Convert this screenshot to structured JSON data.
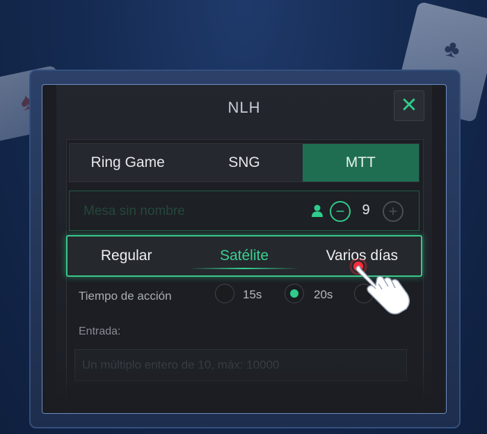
{
  "dialog": {
    "title": "NLH",
    "close_icon": "close-icon",
    "accent_color": "#2fcc8c"
  },
  "game_tabs": [
    {
      "label": "Ring Game",
      "active": false
    },
    {
      "label": "SNG",
      "active": false
    },
    {
      "label": "MTT",
      "active": true
    }
  ],
  "table": {
    "name_placeholder": "Mesa sin nombre",
    "player_icon": "person-icon",
    "player_count": "9",
    "minus_icon": "minus-circle-icon",
    "plus_icon": "plus-circle-icon"
  },
  "mtt_types": [
    {
      "label": "Regular",
      "active": false
    },
    {
      "label": "Satélite",
      "active": true
    },
    {
      "label": "Varios días",
      "active": false
    }
  ],
  "action_time": {
    "label": "Tiempo de acción",
    "options": [
      {
        "label": "15s",
        "selected": false
      },
      {
        "label": "20s",
        "selected": true
      }
    ]
  },
  "entry": {
    "label": "Entrada:",
    "placeholder": "Un múltiplo entero de 10, máx: 10000"
  },
  "tutorial": {
    "pointer_icon": "hand-pointer-icon"
  }
}
